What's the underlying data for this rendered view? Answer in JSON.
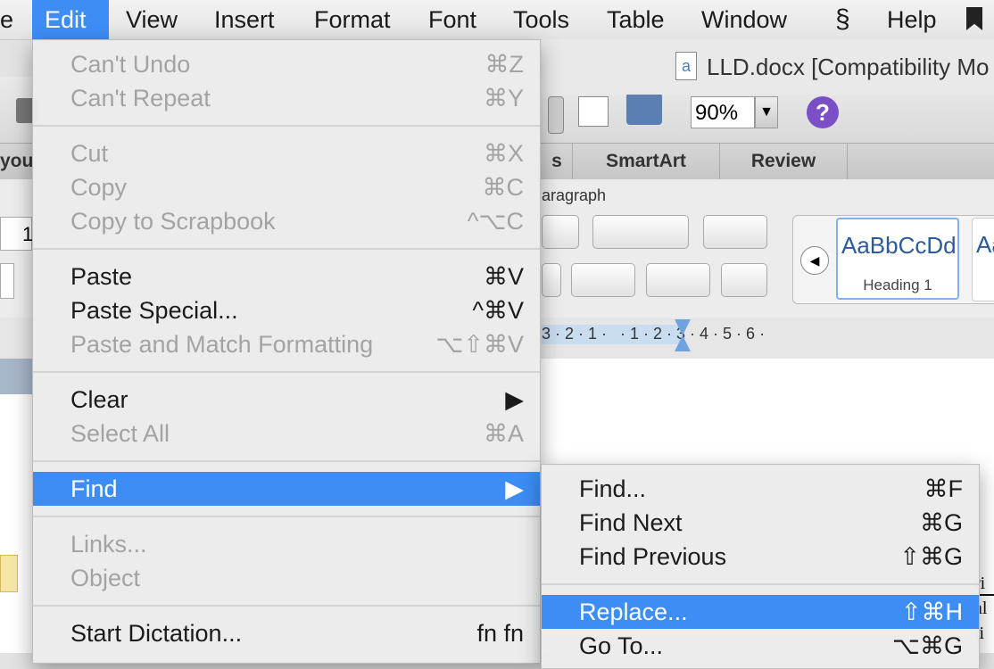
{
  "menubar": {
    "items": [
      "e",
      "Edit",
      "View",
      "Insert",
      "Format",
      "Font",
      "Tools",
      "Table",
      "Window",
      "Help"
    ],
    "script_icon": "script-icon",
    "bookmark_icon": "bookmark-icon"
  },
  "window": {
    "title": "LLD.docx [Compatibility Mo",
    "zoom": "90%",
    "tabs": [
      "you",
      "s",
      "SmartArt",
      "Review"
    ],
    "ribbon_group": "aragraph",
    "style_preview": "AaBbCcDd",
    "style_name": "Heading 1",
    "style_preview_2": "Aa",
    "font_size_partial": "1",
    "ruler_text": "3 · 2 · 1 ·   · 1 · 2 · 3 · 4 · 5 · 6 ·",
    "doc_text": [
      "ri",
      "al",
      "li"
    ]
  },
  "edit_menu": {
    "items": [
      {
        "label": "Can't Undo",
        "shortcut": "⌘Z"
      },
      {
        "label": "Can't Repeat",
        "shortcut": "⌘Y"
      },
      {
        "label": "Cut",
        "shortcut": "⌘X"
      },
      {
        "label": "Copy",
        "shortcut": "⌘C"
      },
      {
        "label": "Copy to Scrapbook",
        "shortcut": "^⌥C"
      },
      {
        "label": "Paste",
        "shortcut": "⌘V"
      },
      {
        "label": "Paste Special...",
        "shortcut": "^⌘V"
      },
      {
        "label": "Paste and Match Formatting",
        "shortcut": "⌥⇧⌘V"
      },
      {
        "label": "Clear",
        "shortcut": "▶"
      },
      {
        "label": "Select All",
        "shortcut": "⌘A"
      },
      {
        "label": "Find",
        "shortcut": "▶"
      },
      {
        "label": "Links...",
        "shortcut": ""
      },
      {
        "label": "Object",
        "shortcut": ""
      },
      {
        "label": "Start Dictation...",
        "shortcut": "fn fn"
      }
    ]
  },
  "find_submenu": {
    "items": [
      {
        "label": "Find...",
        "shortcut": "⌘F"
      },
      {
        "label": "Find Next",
        "shortcut": "⌘G"
      },
      {
        "label": "Find Previous",
        "shortcut": "⇧⌘G"
      },
      {
        "label": "Replace...",
        "shortcut": "⇧⌘H"
      },
      {
        "label": "Go To...",
        "shortcut": "⌥⌘G"
      }
    ]
  },
  "colors": {
    "highlight": "#3d8df5",
    "menu_bg": "#ececec",
    "disabled_text": "#a3a3a3"
  }
}
